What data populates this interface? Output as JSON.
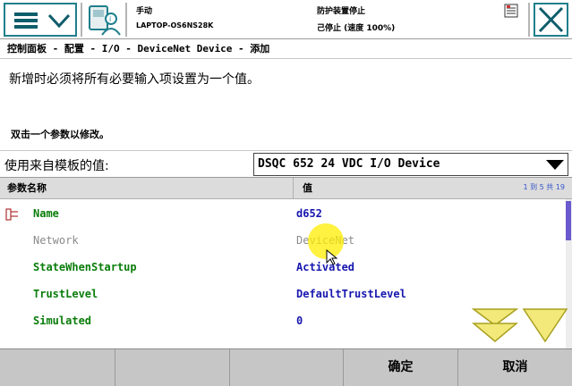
{
  "header": {
    "mode": "手动",
    "host": "LAPTOP-OS6NS28K",
    "guard_status": "防护装置停止",
    "speed_status": "己停止 (速度 100%)"
  },
  "breadcrumb": "控制面板 - 配置 - I/O - DeviceNet Device - 添加",
  "message": {
    "main": "新增时必须将所有必要输入项设置为一个值。",
    "hint": "双击一个参数以修改。"
  },
  "template": {
    "label": "使用来自模板的值:",
    "value": "DSQC 652 24 VDC I/O Device"
  },
  "table": {
    "col_name": "参数名称",
    "col_value": "值",
    "pager": "1 到 5 共 19",
    "rows": [
      {
        "name": "Name",
        "value": "d652"
      },
      {
        "name": "Network",
        "value": "DeviceNet"
      },
      {
        "name": "StateWhenStartup",
        "value": "Activated"
      },
      {
        "name": "TrustLevel",
        "value": "DefaultTrustLevel"
      },
      {
        "name": "Simulated",
        "value": "0"
      }
    ]
  },
  "footer": {
    "ok": "确定",
    "cancel": "取消"
  },
  "colors": {
    "teal_frame": "#1f7f8c",
    "param_name_green": "#0a7d0a",
    "param_value_blue": "#1616b0",
    "disabled_gray": "#8a8a8a",
    "scroll_arrow_yellow": "#f2e97a",
    "bottom_bar": "#c6c6c6"
  },
  "icons": {
    "menu": "menu-icon",
    "menu_chevron": "chevron-down-icon",
    "teach_pendant": "teach-pendant-user-icon",
    "status": "status-log-icon",
    "close": "close-icon",
    "dropdown": "dropdown-arrow-icon",
    "row": "parameter-row-icon",
    "scroll_down": "scroll-down-icon",
    "page_down": "page-down-icon"
  }
}
